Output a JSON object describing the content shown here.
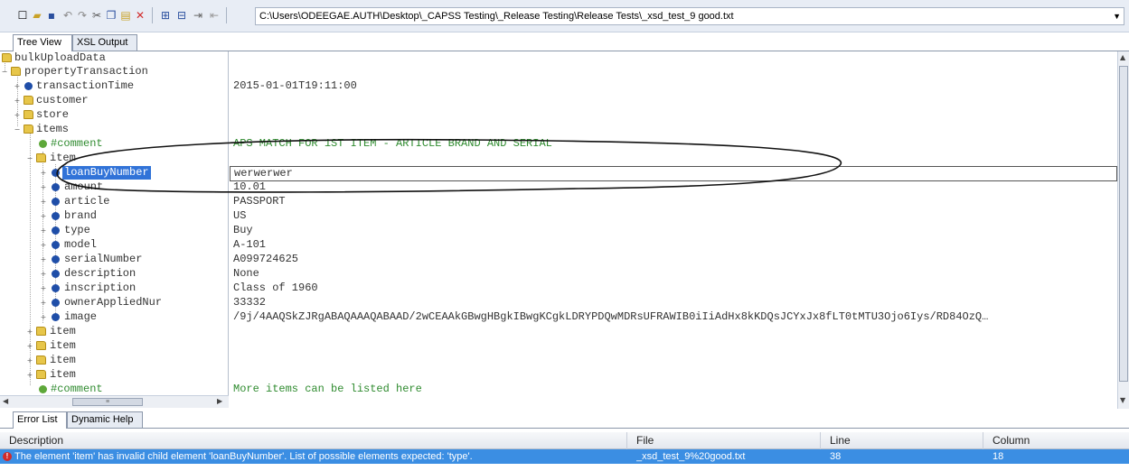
{
  "toolbar": {
    "icons": [
      "new-icon",
      "open-icon",
      "save-icon",
      "undo-icon",
      "redo-icon",
      "cut-icon",
      "copy-icon",
      "paste-icon",
      "delete-icon",
      "expand-icon",
      "collapse-icon",
      "indent-icon",
      "outdent-icon"
    ],
    "path": "C:\\Users\\ODEEGAE.AUTH\\Desktop\\_CAPSS Testing\\_Release Testing\\Release Tests\\_xsd_test_9 good.txt"
  },
  "tabs": {
    "tree_view": "Tree View",
    "xsl_output": "XSL Output"
  },
  "tree": {
    "root": "bulkUploadData",
    "property_transaction": "propertyTransaction",
    "transaction_time": {
      "name": "transactionTime",
      "value": "2015-01-01T19:11:00"
    },
    "customer": "customer",
    "store": "store",
    "items": "items",
    "comment1": {
      "name": "#comment",
      "value": "APS MATCH FOR 1ST ITEM - ARTICLE BRAND AND SERIAL"
    },
    "item": "item",
    "fields": [
      {
        "name": "loanBuyNumber",
        "value": "werwerwer"
      },
      {
        "name": "amount",
        "value": "10.01"
      },
      {
        "name": "article",
        "value": "PASSPORT"
      },
      {
        "name": "brand",
        "value": "US"
      },
      {
        "name": "type",
        "value": "Buy"
      },
      {
        "name": "model",
        "value": "A-101"
      },
      {
        "name": "serialNumber",
        "value": "A099724625"
      },
      {
        "name": "description",
        "value": "None"
      },
      {
        "name": "inscription",
        "value": "Class of 1960"
      },
      {
        "name": "ownerAppliedNur",
        "value": "33332"
      },
      {
        "name": "image",
        "value": "/9j/4AAQSkZJRgABAQAAAQABAAD/2wCEAAkGBwgHBgkIBwgKCgkLDRYPDQwMDRsUFRAWIB0iIiAdHx8kKDQsJCYxJx8fLT0tMTU3Ojo6Iys/RD84OzQ…"
      }
    ],
    "more_items": [
      "item",
      "item",
      "item",
      "item"
    ],
    "comment2": {
      "name": "#comment",
      "value": "More items can be listed here"
    }
  },
  "bottom_tabs": {
    "error_list": "Error List",
    "dynamic_help": "Dynamic Help"
  },
  "error_grid": {
    "headers": {
      "description": "Description",
      "file": "File",
      "line": "Line",
      "column": "Column"
    },
    "row": {
      "description": "The element 'item' has invalid child element 'loanBuyNumber'. List of possible elements expected: 'type'.",
      "file": "_xsd_test_9%20good.txt",
      "line": "38",
      "column": "18"
    }
  }
}
